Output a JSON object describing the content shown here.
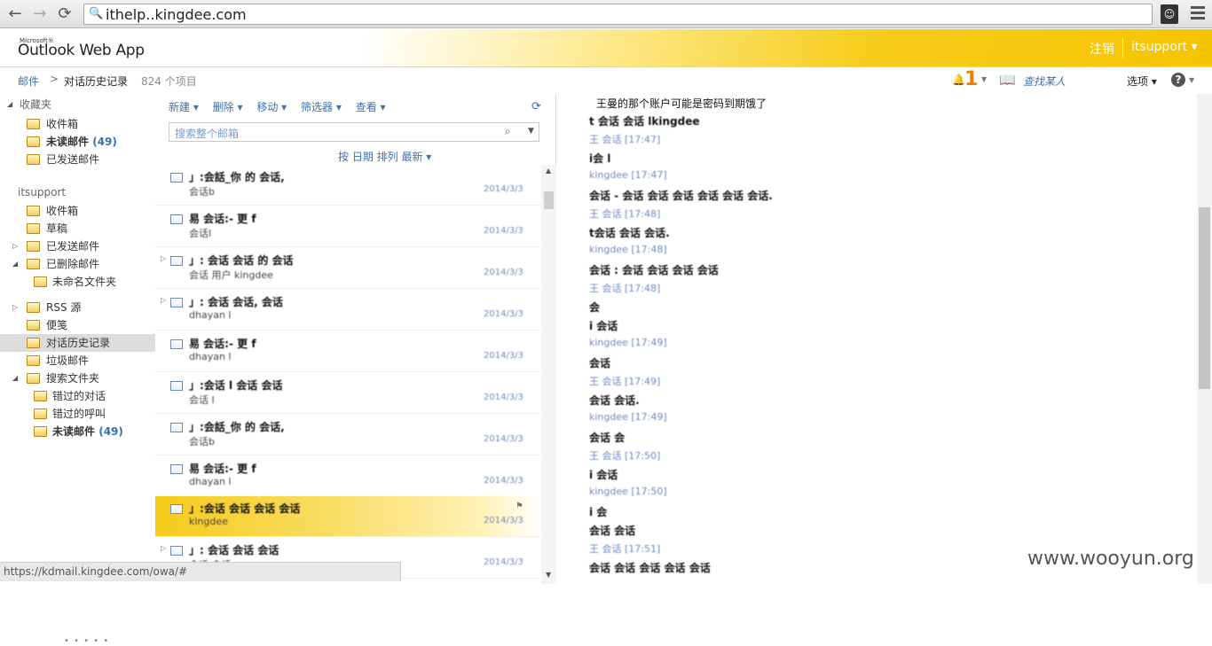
{
  "browser": {
    "url": "ithelp..kingdee.com",
    "back": "←",
    "forward": "→",
    "reload": "C",
    "ext_icon": "user-mask-icon"
  },
  "header": {
    "brand_ms": "Microsoft®",
    "brand": "Outlook Web App",
    "logout": "注销",
    "user": "itsupport ▾"
  },
  "breadcrumb": {
    "mail": "邮件",
    "sep": ">",
    "folder": "对话历史记录",
    "count": "824 个项目",
    "notif_count": "1",
    "find_people": "查找某人",
    "options": "选项",
    "help": "?"
  },
  "nav": {
    "favorites": "收藏夹",
    "fav_items": [
      {
        "label": "收件箱",
        "count": ""
      },
      {
        "label": "未读邮件",
        "count": "(49)"
      },
      {
        "label": "已发送邮件",
        "count": ""
      }
    ],
    "mailbox": "itsupport",
    "items": [
      {
        "label": "收件箱",
        "count": ""
      },
      {
        "label": "草稿",
        "count": ""
      },
      {
        "label": "已发送邮件",
        "count": ""
      },
      {
        "label": "已删除邮件",
        "count": ""
      },
      {
        "label": "未命名文件夹",
        "count": ""
      },
      {
        "label": "RSS 源",
        "count": ""
      },
      {
        "label": "便笺",
        "count": ""
      },
      {
        "label": "对话历史记录",
        "count": ""
      },
      {
        "label": "垃圾邮件",
        "count": ""
      },
      {
        "label": "搜索文件夹",
        "count": ""
      },
      {
        "label": "错过的对话",
        "count": ""
      },
      {
        "label": "错过的呼叫",
        "count": ""
      },
      {
        "label": "未读邮件",
        "count": "(49)"
      }
    ],
    "grip": "• • • • •"
  },
  "list": {
    "toolbar": [
      "新建 ▾",
      "删除 ▾",
      "移动 ▾",
      "筛选器 ▾",
      "查看 ▾"
    ],
    "search_placeholder": "搜索整个邮箱",
    "arrange": "按 日期 排列 最新 ▾",
    "messages": [
      {
        "line1": "」:会話_你 的 会话,",
        "line2": "会话b",
        "time": "2014/3/3"
      },
      {
        "line1": "易 会话:- 更 f",
        "line2": "会话l",
        "time": "2014/3/3"
      },
      {
        "line1": "」: 会话 会话 的 会话",
        "line2": "会话 用户 kingdee",
        "time": "2014/3/3"
      },
      {
        "line1": "」: 会话 会话, 会话",
        "line2": "dhayan l",
        "time": "2014/3/3"
      },
      {
        "line1": "易 会话:- 更 f",
        "line2": "dhayan l",
        "time": "2014/3/3"
      },
      {
        "line1": "」:会话 l 会话 会话",
        "line2": "会话 l",
        "time": "2014/3/3"
      },
      {
        "line1": "」:会話_你 的 会话,",
        "line2": "会话b",
        "time": "2014/3/3"
      },
      {
        "line1": "易 会话:- 更 f",
        "line2": "dhayan l",
        "time": "2014/3/3"
      },
      {
        "line1": "」:会话 会话 会话 会话",
        "line2": "kingdee",
        "time": "2014/3/3"
      },
      {
        "line1": "」: 会话 会话 会话",
        "line2": "会话 会话",
        "time": "2014/3/3"
      }
    ]
  },
  "reading": {
    "subject": "王曼的那个账户可能是密码到期饿了",
    "lines": [
      {
        "kind": "body",
        "text": "t 会话 会话 lkingdee"
      },
      {
        "kind": "from",
        "text": "王 会话 [17:47]"
      },
      {
        "kind": "body",
        "text": "i会 l"
      },
      {
        "kind": "from",
        "text": "kingdee [17:47]"
      },
      {
        "kind": "body",
        "text": "会话 - 会话 会话 会话 会话 会话 会话."
      },
      {
        "kind": "from",
        "text": "王 会话 [17:48]"
      },
      {
        "kind": "body",
        "text": "t会话 会话 会话."
      },
      {
        "kind": "from",
        "text": "kingdee [17:48]"
      },
      {
        "kind": "body",
        "text": "会话 : 会话 会话 会话 会话"
      },
      {
        "kind": "from",
        "text": "王 会话 [17:48]"
      },
      {
        "kind": "body",
        "text": "会"
      },
      {
        "kind": "body",
        "text": "i 会话"
      },
      {
        "kind": "from",
        "text": "kingdee [17:49]"
      },
      {
        "kind": "body",
        "text": "会话"
      },
      {
        "kind": "from",
        "text": "王 会话 [17:49]"
      },
      {
        "kind": "body",
        "text": "会话 会话."
      },
      {
        "kind": "from",
        "text": "kingdee [17:49]"
      },
      {
        "kind": "body",
        "text": "会话 会"
      },
      {
        "kind": "from",
        "text": "王 会话 [17:50]"
      },
      {
        "kind": "body",
        "text": "i 会话"
      },
      {
        "kind": "from",
        "text": "kingdee [17:50]"
      },
      {
        "kind": "body",
        "text": "i 会"
      },
      {
        "kind": "body",
        "text": "会话 会话"
      },
      {
        "kind": "from",
        "text": "王 会话 [17:51]"
      },
      {
        "kind": "body",
        "text": "会话 会话 会话 会话 会话"
      }
    ]
  },
  "watermark": "www.wooyun.org",
  "status": "https://kdmail.kingdee.com/owa/#",
  "colors": {
    "accent": "#f5c400",
    "link": "#3a6fb0",
    "selected_row": "#dcdcdc"
  }
}
